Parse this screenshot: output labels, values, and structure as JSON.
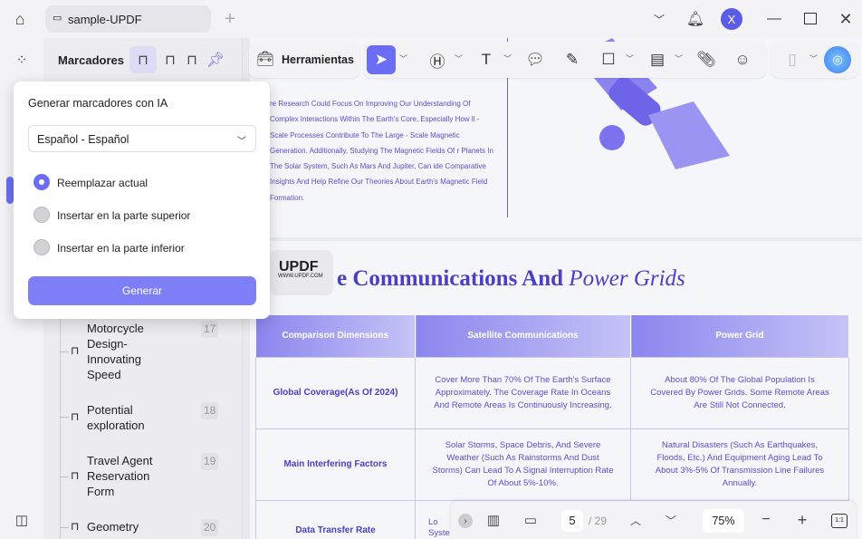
{
  "window": {
    "tab_title": "sample-UPDF",
    "avatar_letter": "X"
  },
  "panel": {
    "title": "Marcadores"
  },
  "bookmarks": [
    {
      "label": "Motorcycle Design-Innovating Speed",
      "page": "17"
    },
    {
      "label": "Potential exploration",
      "page": "18"
    },
    {
      "label": "Travel Agent Reservation Form",
      "page": "19"
    },
    {
      "label": "Geometry",
      "page": "20"
    }
  ],
  "toolbar": {
    "tools_label": "Herramientas"
  },
  "popup": {
    "title": "Generar marcadores con IA",
    "language": "Español - Español",
    "options": [
      "Reemplazar actual",
      "Insertar en la parte superior",
      "Insertar en la parte inferior"
    ],
    "selected": 0,
    "button": "Generar"
  },
  "document": {
    "paragraph": "re Research Could Focus On Improving Our Understanding Of Complex Interactions Within The Earth's Core, Especially How ll - Scale Processes Contribute To The Large - Scale Magnetic Generation. Additionally, Studying The Magnetic Fields Of r Planets In The Solar System, Such As Mars And Jupiter, Can ide Comparative Insights And Help Refine Our Theories About Earth's Magnetic Field Formation.",
    "heading_bold": "e Communications And",
    "heading_italic": "Power Grids",
    "watermark": {
      "brand": "UPDF",
      "url": "WWW.UPDF.COM"
    },
    "table": {
      "headers": [
        "Comparison Dimensions",
        "Satellite Communications",
        "Power Grid"
      ],
      "rows": [
        [
          "Global Coverage(As Of 2024)",
          "Cover More Than 70% Of The Earth's Surface Approximately. The Coverage Rate In Oceans And Remote Areas Is Continuously Increasing.",
          "About 80% Of The Global Population Is Covered By Power Grids. Some Remote Areas Are Still Not Connected."
        ],
        [
          "Main Interfering Factors",
          "Solar Storms, Space Debris, And Severe Weather (Such As Rainstorms And Dust Storms) Can Lead To A Signal Interruption Rate Of About 5%-10%.",
          "Natural Disasters (Such As Earthquakes, Floods, Etc.) And Equipment Aging Lead To About 3%-5% Of Transmission Line Failures Annually."
        ],
        [
          "Data Transfer Rate",
          "Lo Syste",
          ""
        ]
      ]
    }
  },
  "bottombar": {
    "page": "5",
    "total": "/ 29",
    "zoom": "75%",
    "fit_label": "1:1"
  },
  "colors": {
    "accent": "#6b6ef5",
    "text_purple": "#5a4fd0"
  }
}
